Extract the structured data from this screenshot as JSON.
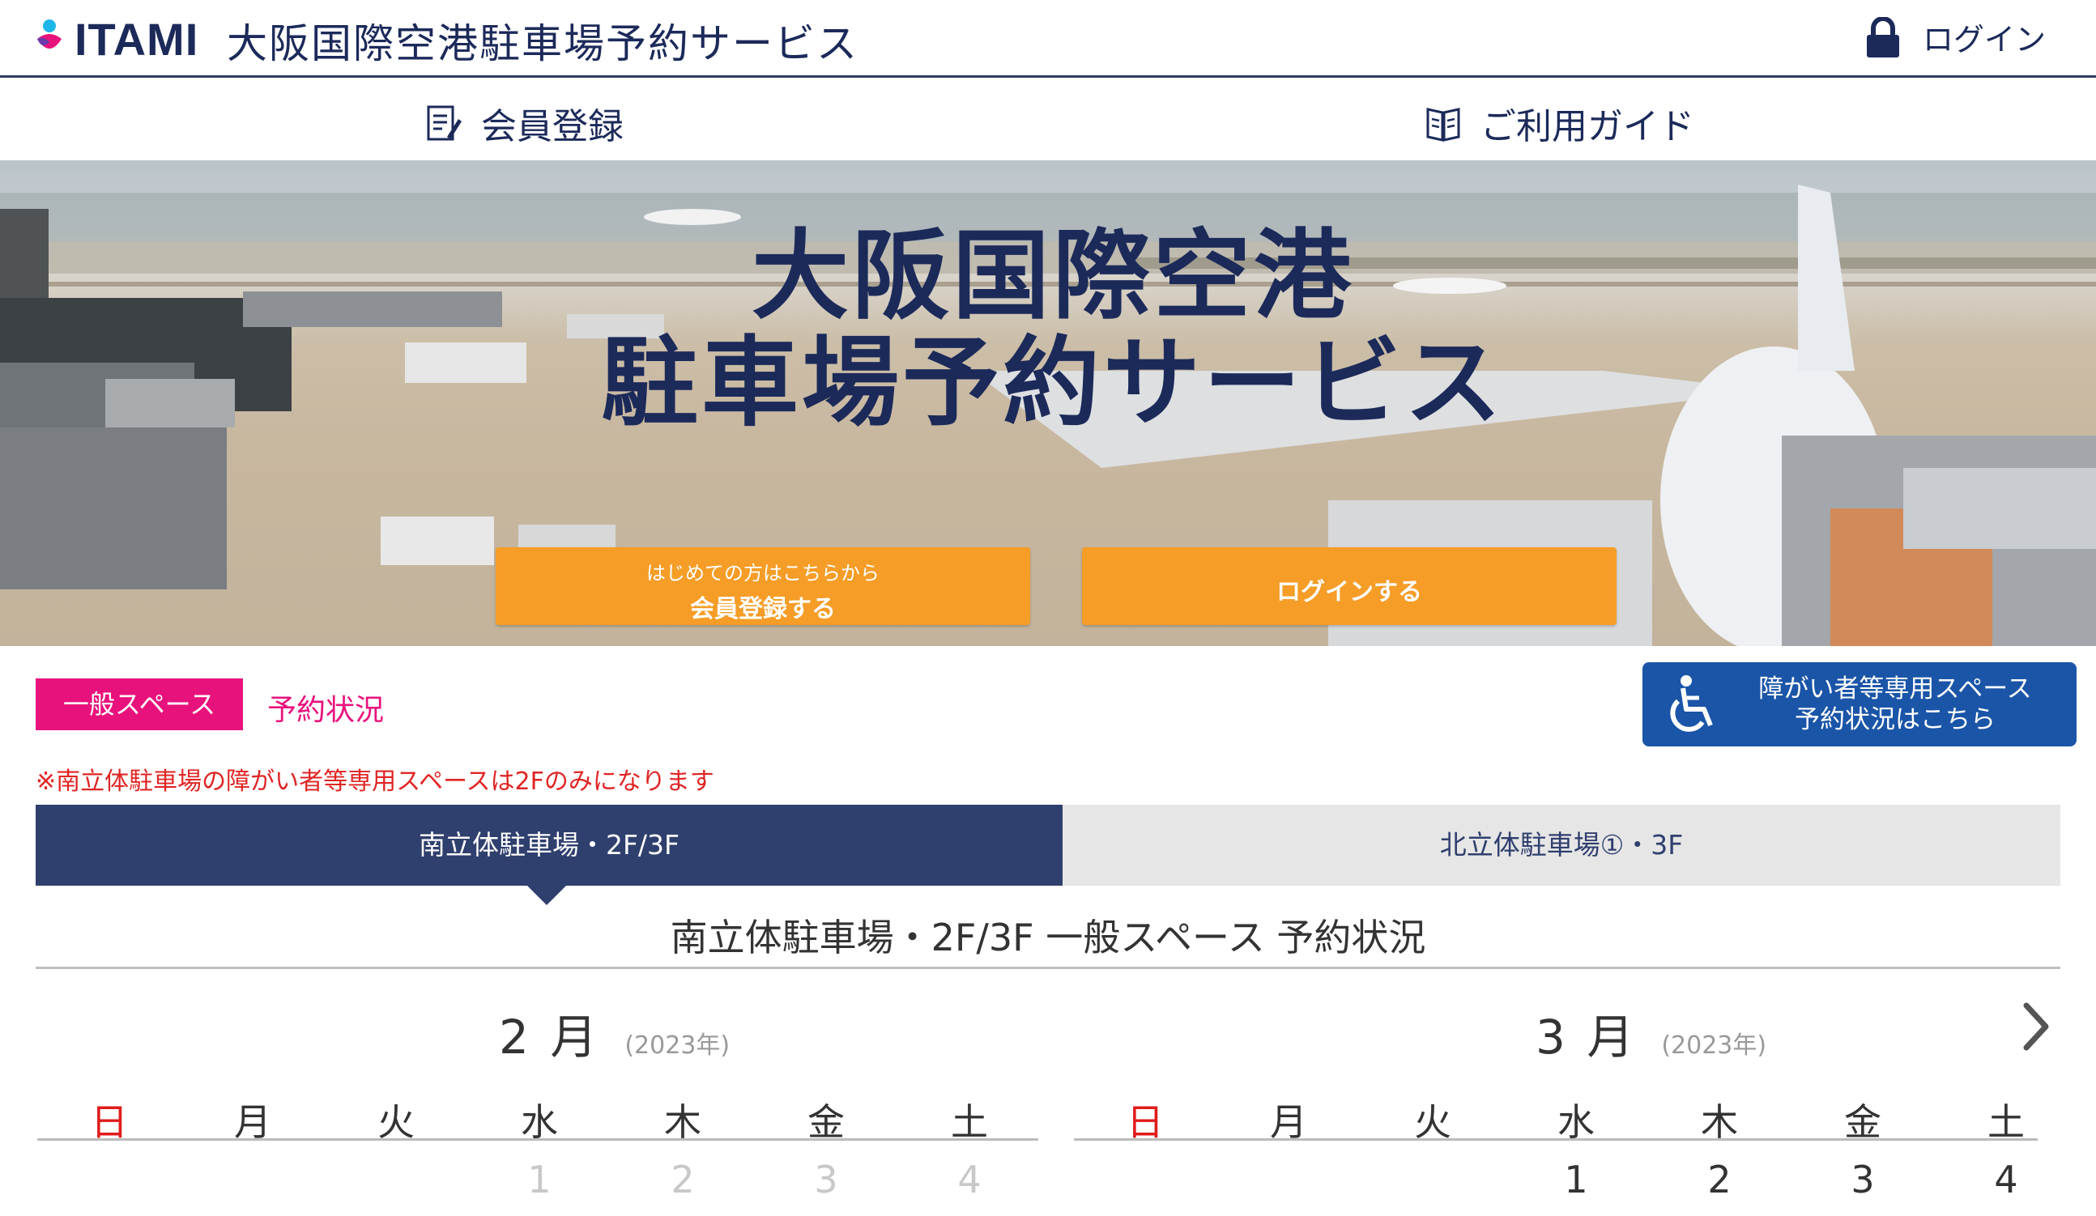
{
  "header": {
    "logo_text": "ITAMI",
    "service_title": "大阪国際空港駐車場予約サービス",
    "login_label": "ログイン"
  },
  "nav": {
    "register_label": "会員登録",
    "guide_label": "ご利用ガイド"
  },
  "hero": {
    "title_line1": "大阪国際空港",
    "title_line2": "駐車場予約サービス",
    "register_button_small": "はじめての方はこちらから",
    "register_button_big": "会員登録する",
    "login_button": "ログインする"
  },
  "section": {
    "general_tag": "一般スペース",
    "status_label": "予約状況",
    "accessible_line1": "障がい者等専用スペース",
    "accessible_line2": "予約状況はこちら",
    "notice": "※南立体駐車場の障がい者等専用スペースは2Fのみになります"
  },
  "tabs": [
    {
      "label": "南立体駐車場・2F/3F",
      "active": true
    },
    {
      "label": "北立体駐車場①・3F",
      "active": false
    }
  ],
  "status_title": "南立体駐車場・2F/3F  一般スペース  予約状況",
  "calendars": [
    {
      "month": "2 月",
      "year": "(2023年)",
      "weekdays": [
        "日",
        "月",
        "火",
        "水",
        "木",
        "金",
        "土"
      ],
      "first_row": [
        "",
        "",
        "",
        "1",
        "2",
        "3",
        "4"
      ]
    },
    {
      "month": "3 月",
      "year": "(2023年)",
      "weekdays": [
        "日",
        "月",
        "火",
        "水",
        "木",
        "金",
        "土"
      ],
      "first_row": [
        "",
        "",
        "",
        "1",
        "2",
        "3",
        "4"
      ]
    }
  ],
  "colors": {
    "navy": "#1c2a5a",
    "tab_active": "#2f3f6e",
    "accent_orange": "#f59d27",
    "accent_pink": "#e8127c",
    "accessible_blue": "#1a55a8",
    "notice_red": "#e02424"
  },
  "icons": {
    "logo": "itami-logo-mark",
    "login": "lock-icon",
    "register": "pen-paper-icon",
    "guide": "book-icon",
    "accessible": "wheelchair-icon",
    "next": "chevron-right-icon"
  }
}
